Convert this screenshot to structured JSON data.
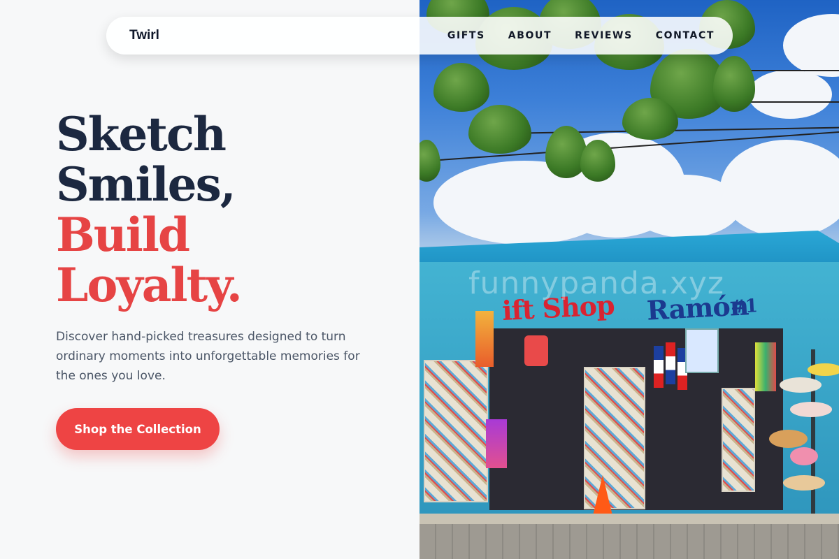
{
  "nav": {
    "brand": "Twirl",
    "links": [
      "GIFTS",
      "ABOUT",
      "REVIEWS",
      "CONTACT"
    ]
  },
  "hero": {
    "headline_line1": "Sketch",
    "headline_line2": "Smiles,",
    "headline_line3": "Build",
    "headline_line4": "Loyalty.",
    "subtitle": "Discover hand-picked treasures designed to turn ordinary moments into unforgettable memories for the ones you love.",
    "cta_label": "Shop the Collection"
  },
  "photo": {
    "sign_left": "ift Shop",
    "sign_right": "Ramón",
    "sign_number": "#1",
    "watermark": "funnypanda.xyz"
  },
  "colors": {
    "accent": "#ee4444",
    "heading_dark": "#1c2840",
    "heading_red": "#e64444",
    "body_text": "#4a5566",
    "background": "#f7f8f9"
  }
}
